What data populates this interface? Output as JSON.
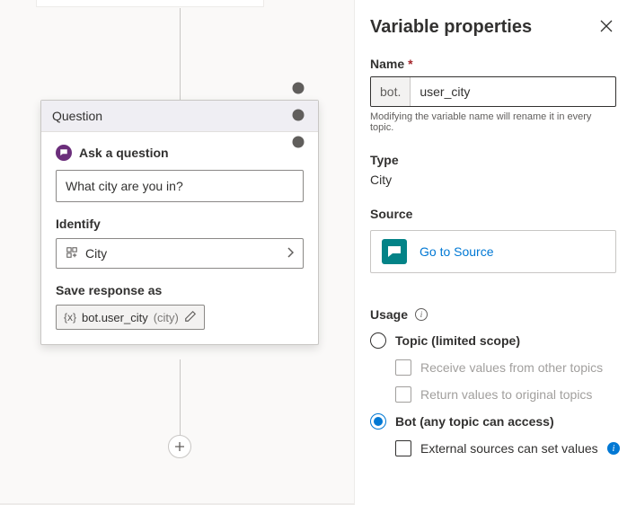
{
  "card": {
    "header": "Question",
    "ask_label": "Ask a question",
    "question_text": "What city are you in?",
    "identify_label": "Identify",
    "identify_value": "City",
    "save_label": "Save response as",
    "chip_prefix": "{x}",
    "chip_name": "bot.user_city",
    "chip_type": "(city)"
  },
  "panel": {
    "title": "Variable properties",
    "name_label": "Name",
    "name_prefix": "bot.",
    "name_value": "user_city",
    "name_helper": "Modifying the variable name will rename it in every topic.",
    "type_label": "Type",
    "type_value": "City",
    "source_label": "Source",
    "source_link": "Go to Source",
    "usage_label": "Usage",
    "topic_option": "Topic (limited scope)",
    "receive_option": "Receive values from other topics",
    "return_option": "Return values to original topics",
    "bot_option": "Bot (any topic can access)",
    "external_option": "External sources can set values"
  }
}
